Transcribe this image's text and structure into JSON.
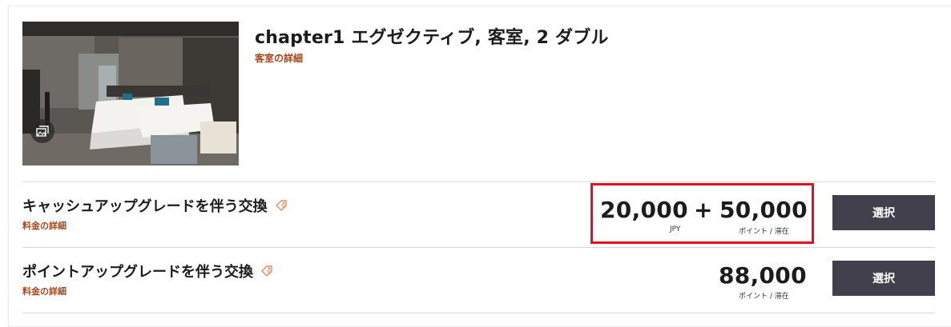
{
  "room": {
    "title": "chapter1 エグゼクティブ, 客室, 2 ダブル",
    "details_link": "客室の詳細",
    "photo_icon": "gallery-icon"
  },
  "rates": [
    {
      "title": "キャッシュアップグレードを伴う交換",
      "tag_icon": "tag-icon",
      "details_link": "料金の詳細",
      "cash_amount": "20,000",
      "plus": "+",
      "points_amount": "50,000",
      "cash_unit": "JPY",
      "points_unit": "ポイント / 滞在",
      "select_label": "選択"
    },
    {
      "title": "ポイントアップグレードを伴う交換",
      "tag_icon": "tag-icon",
      "details_link": "料金の詳細",
      "points_amount": "88,000",
      "points_unit": "ポイント / 滞在",
      "select_label": "選択"
    }
  ],
  "colors": {
    "link": "#a6461e",
    "button": "#43404d",
    "highlight": "#e0101e",
    "tag_icon": "#e8875a"
  }
}
